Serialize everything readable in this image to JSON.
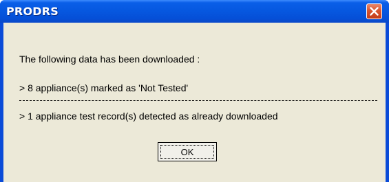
{
  "window": {
    "title": "PRODRS",
    "close_icon": "close-x-icon"
  },
  "message": {
    "intro": "The following data has been downloaded :",
    "not_tested": "> 8 appliance(s) marked as 'Not Tested'",
    "already_downloaded": "> 1 appliance test record(s) detected as already downloaded"
  },
  "buttons": {
    "ok_label": "OK"
  },
  "colors": {
    "titlebar": "#0658e0",
    "client_background": "#ece9d8",
    "close_button": "#d8542e"
  }
}
